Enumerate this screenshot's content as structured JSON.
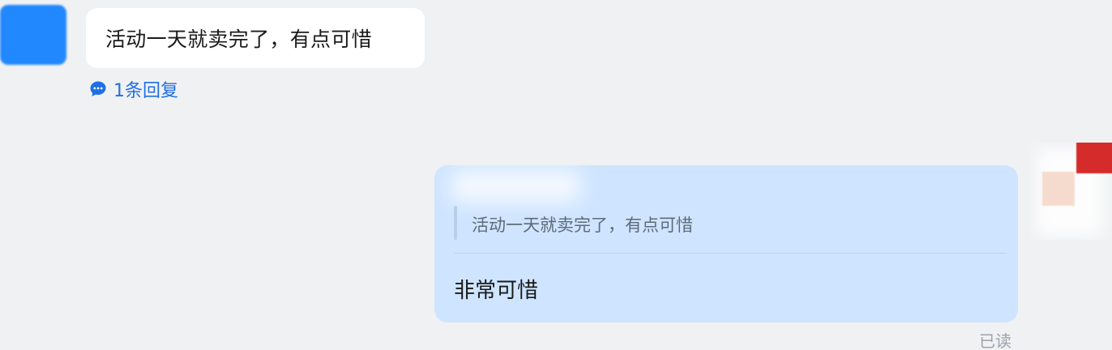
{
  "incoming_message": {
    "text": "活动一天就卖完了，有点可惜",
    "reply_count_label": "1条回复"
  },
  "outgoing_message": {
    "quoted_text": "活动一天就卖完了，有点可惜",
    "text": "非常可惜",
    "status": "已读"
  },
  "icons": {
    "reply": "chat-bubble-icon"
  },
  "colors": {
    "background": "#f0f1f3",
    "incoming_bubble": "#ffffff",
    "outgoing_bubble": "#cfe5ff",
    "link": "#1f6fe6",
    "avatar_left": "#1e86ff",
    "avatar_right_red": "#d62b2b"
  }
}
